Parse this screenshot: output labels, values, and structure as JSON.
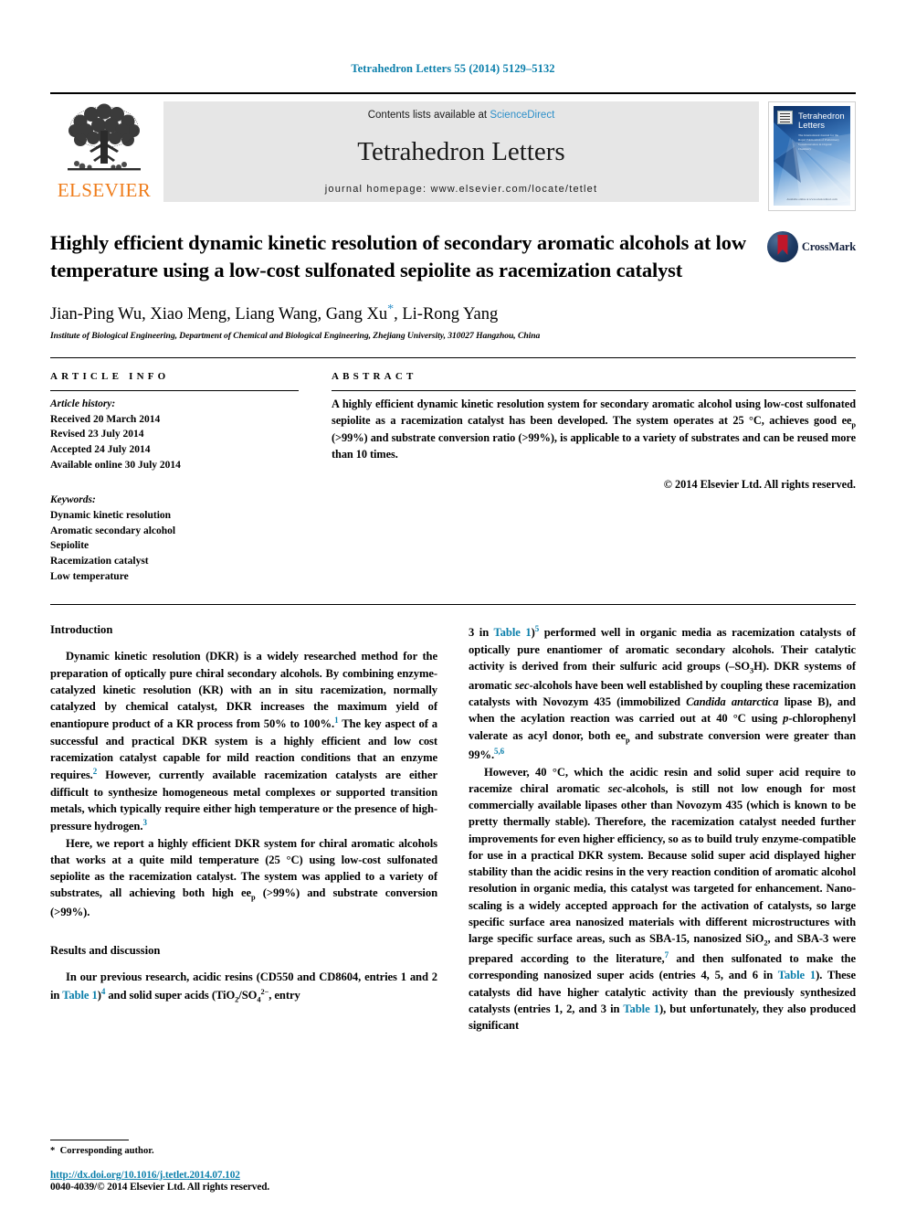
{
  "running_head": "Tetrahedron Letters 55 (2014) 5129–5132",
  "masthead": {
    "publisher_word": "ELSEVIER",
    "contents_prefix": "Contents lists available at ",
    "sciencedirect": "ScienceDirect",
    "journal_name": "Tetrahedron Letters",
    "homepage": "journal homepage: www.elsevier.com/locate/tetlet",
    "cover": {
      "title_line1": "Tetrahedron",
      "title_line2": "Letters",
      "subtitle": "The International Journal for the Rapid Publication of Preliminary Communication in Organic Chemistry",
      "footer": "Available online at www.sciencedirect.com"
    }
  },
  "article": {
    "title": "Highly efficient dynamic kinetic resolution of secondary aromatic alcohols at low temperature using a low-cost sulfonated sepiolite as racemization catalyst",
    "crossmark_label": "CrossMark",
    "authors": "Jian-Ping Wu, Xiao Meng, Liang Wang, Gang Xu",
    "authors_tail": ", Li-Rong Yang",
    "corresponding_marker": "*",
    "affiliation": "Institute of Biological Engineering, Department of Chemical and Biological Engineering, Zhejiang University, 310027 Hangzhou, China"
  },
  "article_info": {
    "heading": "ARTICLE INFO",
    "history_heading": "Article history:",
    "history": [
      "Received 20 March 2014",
      "Revised 23 July 2014",
      "Accepted 24 July 2014",
      "Available online 30 July 2014"
    ],
    "keywords_heading": "Keywords:",
    "keywords": [
      "Dynamic kinetic resolution",
      "Aromatic secondary alcohol",
      "Sepiolite",
      "Racemization catalyst",
      "Low temperature"
    ]
  },
  "abstract": {
    "heading": "ABSTRACT",
    "text_part1": "A highly efficient dynamic kinetic resolution system for secondary aromatic alcohol using low-cost sulfonated sepiolite as a racemization catalyst has been developed. The system operates at 25 °C, achieves good ee",
    "text_sub1": "p",
    "text_part2": " (>99%) and substrate conversion ratio (>99%), is applicable to a variety of substrates and can be reused more than 10 times.",
    "copyright": "© 2014 Elsevier Ltd. All rights reserved."
  },
  "body": {
    "section_introduction": "Introduction",
    "section_results": "Results and discussion",
    "intro_p1_a": "Dynamic kinetic resolution (DKR) is a widely researched method for the preparation of optically pure chiral secondary alcohols. By combining enzyme-catalyzed kinetic resolution (KR) with an in situ racemization, normally catalyzed by chemical catalyst, DKR increases the maximum yield of enantiopure product of a KR process from 50% to 100%.",
    "intro_p1_ref1": "1",
    "intro_p1_b": " The key aspect of a successful and practical DKR system is a highly efficient and low cost racemization catalyst capable for mild reaction conditions that an enzyme requires.",
    "intro_p1_ref2": "2",
    "intro_p1_c": " However, currently available racemization catalysts are either difficult to synthesize homogeneous metal complexes or supported transition metals, which typically require either high temperature or the presence of high-pressure hydrogen.",
    "intro_p1_ref3": "3",
    "intro_p2": "Here, we report a highly efficient DKR system for chiral aromatic alcohols that works at a quite mild temperature (25 °C) using low-cost sulfonated sepiolite as the racemization catalyst. The system was applied to a variety of substrates, all achieving both high ee",
    "intro_p2_sub": "p",
    "intro_p2_b": " (>99%) and substrate conversion (>99%).",
    "results_p1_a": "In our previous research, acidic resins (CD550 and CD8604, entries 1 and 2 in ",
    "results_p1_link1": "Table 1",
    "results_p1_b": ")",
    "results_p1_ref4": "4",
    "results_p1_c": " and solid super acids (TiO",
    "results_p1_sub1": "2",
    "results_p1_d": "/SO",
    "results_p1_sub2": "4",
    "results_p1_sup2": "2−",
    "results_p1_e": ", entry",
    "right_p1_a": "3 in ",
    "right_p1_link": "Table 1",
    "right_p1_b": ")",
    "right_p1_ref5": "5",
    "right_p1_c": " performed well in organic media as racemization catalysts of optically pure enantiomer of aromatic secondary alcohols. Their catalytic activity is derived from their sulfuric acid groups (–SO",
    "right_p1_sub3": "3",
    "right_p1_d": "H). DKR systems of aromatic ",
    "right_p1_italic1": "sec",
    "right_p1_e": "-alcohols have been well established by coupling these racemization catalysts with Novozym 435 (immobilized ",
    "right_p1_italic2": "Candida antarctica",
    "right_p1_f": " lipase B), and when the acylation reaction was carried out at 40 °C using ",
    "right_p1_italic3": "p",
    "right_p1_g": "-chlorophenyl valerate as acyl donor, both ee",
    "right_p1_sub4": "p",
    "right_p1_h": " and substrate conversion were greater than 99%.",
    "right_p1_ref56": "5,6",
    "right_p2_a": "However, 40 °C, which the acidic resin and solid super acid require to racemize chiral aromatic ",
    "right_p2_italic1": "sec",
    "right_p2_b": "-alcohols, is still not low enough for most commercially available lipases other than Novozym 435 (which is known to be pretty thermally stable). Therefore, the racemization catalyst needed further improvements for even higher efficiency, so as to build truly enzyme-compatible for use in a practical DKR system. Because solid super acid displayed higher stability than the acidic resins in the very reaction condition of aromatic alcohol resolution in organic media, this catalyst was targeted for enhancement. Nano-scaling is a widely accepted approach for the activation of catalysts, so large specific surface area nanosized materials with different microstructures with large specific surface areas, such as SBA-15, nanosized SiO",
    "right_p2_sub1": "2",
    "right_p2_c": ", and SBA-3 were prepared according to the literature,",
    "right_p2_ref7": "7",
    "right_p2_d": " and then sulfonated to make the corresponding nanosized super acids (entries 4, 5, and 6 in ",
    "right_p2_link1": "Table 1",
    "right_p2_e": "). These catalysts did have higher catalytic activity than the previously synthesized catalysts (entries 1, 2, and 3 in ",
    "right_p2_link2": "Table 1",
    "right_p2_f": "), but unfortunately, they also produced significant"
  },
  "footer": {
    "footnote_marker": "*",
    "footnote_text": "Corresponding author.",
    "doi": "http://dx.doi.org/10.1016/j.tetlet.2014.07.102",
    "issn_line": "0040-4039/© 2014 Elsevier Ltd. All rights reserved."
  },
  "colors": {
    "link_blue": "#0b7fab",
    "sciencedirect_blue": "#2c8fc9",
    "elsevier_orange": "#ef7c1a",
    "crossmark_red": "#c0172a",
    "crossmark_navy": "#13274a"
  }
}
